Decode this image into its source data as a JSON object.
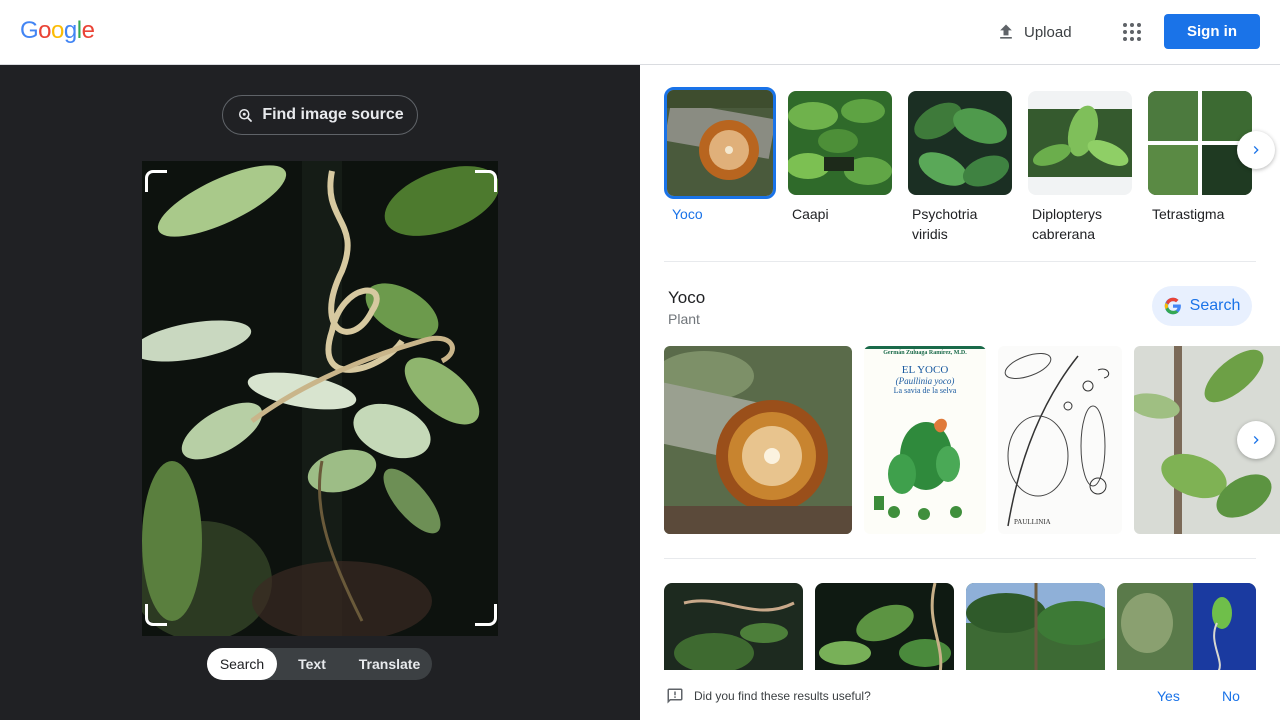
{
  "header": {
    "logo_letters": [
      {
        "ch": "G",
        "color": "#4285F4"
      },
      {
        "ch": "o",
        "color": "#EA4335"
      },
      {
        "ch": "o",
        "color": "#FBBC05"
      },
      {
        "ch": "g",
        "color": "#4285F4"
      },
      {
        "ch": "l",
        "color": "#34A853"
      },
      {
        "ch": "e",
        "color": "#EA4335"
      }
    ],
    "upload_label": "Upload",
    "upload_icon": "upload-icon",
    "apps_icon": "apps-grid-icon",
    "signin_label": "Sign in"
  },
  "left_panel": {
    "find_source_label": "Find image source",
    "find_source_icon": "lens-search-icon",
    "modes": [
      {
        "label": "Search",
        "active": true
      },
      {
        "label": "Text",
        "active": false
      },
      {
        "label": "Translate",
        "active": false
      }
    ]
  },
  "chips": [
    {
      "label": "Yoco",
      "selected": true
    },
    {
      "label": "Caapi",
      "selected": false
    },
    {
      "label": "Psychotria viridis",
      "selected": false
    },
    {
      "label": "Diplopterys cabrerana",
      "selected": false
    },
    {
      "label": "Tetrastigma",
      "selected": false
    }
  ],
  "result": {
    "title": "Yoco",
    "subtitle": "Plant",
    "search_button_label": "Search",
    "book_cover": {
      "author": "Germán Zuluaga Ramírez, M.D.",
      "title": "EL YOCO",
      "latin": "(Paullinia yoco)",
      "subtitle": "La savia de la selva"
    },
    "illustration_caption": "PAULLINIA"
  },
  "feedback": {
    "question": "Did you find these results useful?",
    "yes_label": "Yes",
    "no_label": "No"
  },
  "colors": {
    "accent": "#1a73e8",
    "dark_panel": "#202124"
  }
}
